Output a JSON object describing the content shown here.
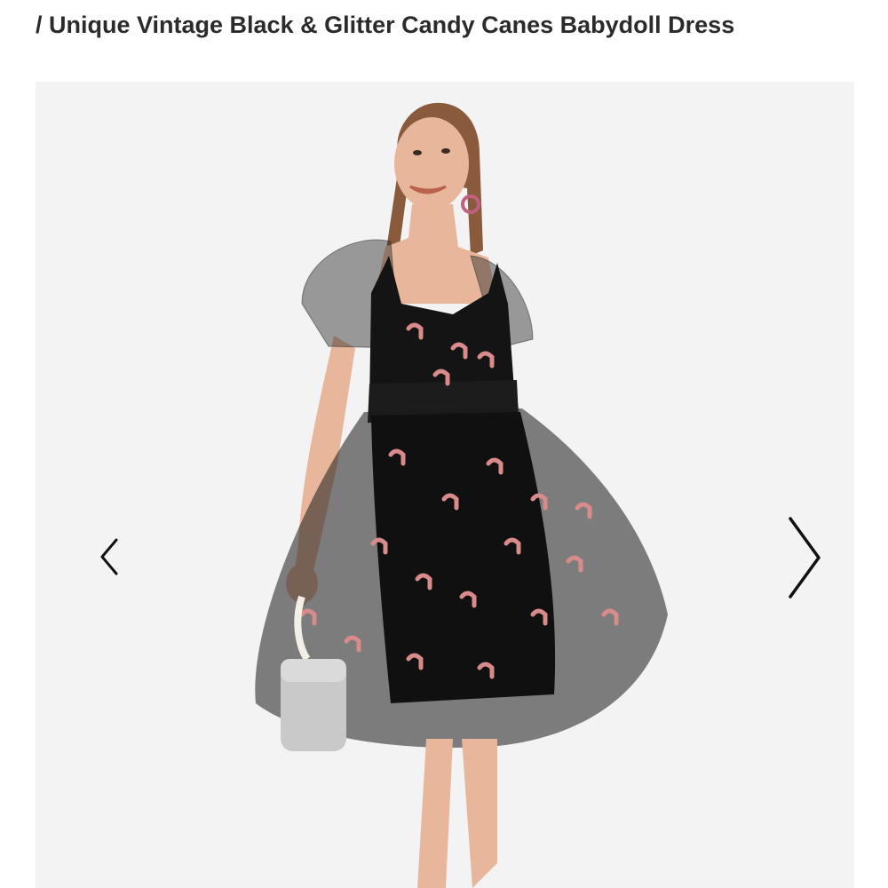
{
  "breadcrumb": {
    "title": "/ Unique Vintage Black & Glitter Candy Canes Babydoll Dress"
  },
  "gallery": {
    "prev_icon": "chevron-left-icon",
    "next_icon": "chevron-right-icon",
    "colors": {
      "background": "#f3f3f3",
      "dress": "#141414",
      "candy_cane_pattern": "#d98a8a",
      "bag": "#c9c9c9",
      "arrow": "#111111"
    }
  }
}
